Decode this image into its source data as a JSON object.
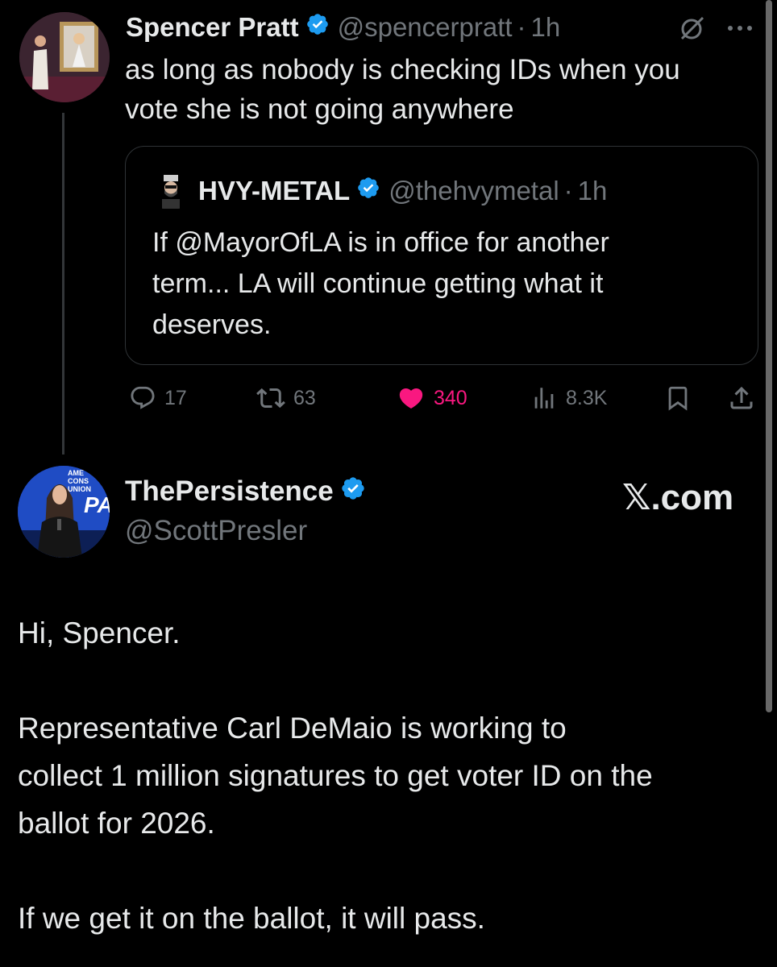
{
  "tweet": {
    "author_name": "Spencer Pratt",
    "handle": "@spencerpratt",
    "time": "1h",
    "text_line1": "as long as nobody is checking IDs when you",
    "text_line2": "vote she is not going anywhere",
    "quote": {
      "author_name": "HVY-METAL",
      "handle": "@thehvymetal",
      "time": "1h",
      "line1": "If @MayorOfLA is in office for another",
      "line2": "term... LA will continue getting what it",
      "line3": "deserves."
    },
    "actions": {
      "replies": "17",
      "reposts": "63",
      "likes": "340",
      "views": "8.3K"
    }
  },
  "reply": {
    "author_name": "ThePersistence",
    "handle": "@ScottPresler",
    "watermark": "𝕏.com",
    "avatar_text": "AMERICAN CONSERVATIVE UNION",
    "avatar_logo": "CPA",
    "para1": "Hi, Spencer.",
    "para2_line1": "Representative Carl DeMaio is working to",
    "para2_line2": "collect 1 million signatures to get voter ID on the",
    "para2_line3": "ballot for 2026.",
    "para3": "If we get it on the ballot, it will pass."
  },
  "colors": {
    "background": "#000000",
    "text": "#e7e9ea",
    "secondary": "#71767b",
    "verified": "#1d9bf0",
    "like": "#f91880",
    "border": "#2f3336"
  },
  "icons": [
    "verified-badge-icon",
    "grok-icon",
    "more-icon",
    "reply-icon",
    "repost-icon",
    "heart-icon",
    "views-icon",
    "bookmark-icon",
    "share-icon"
  ]
}
